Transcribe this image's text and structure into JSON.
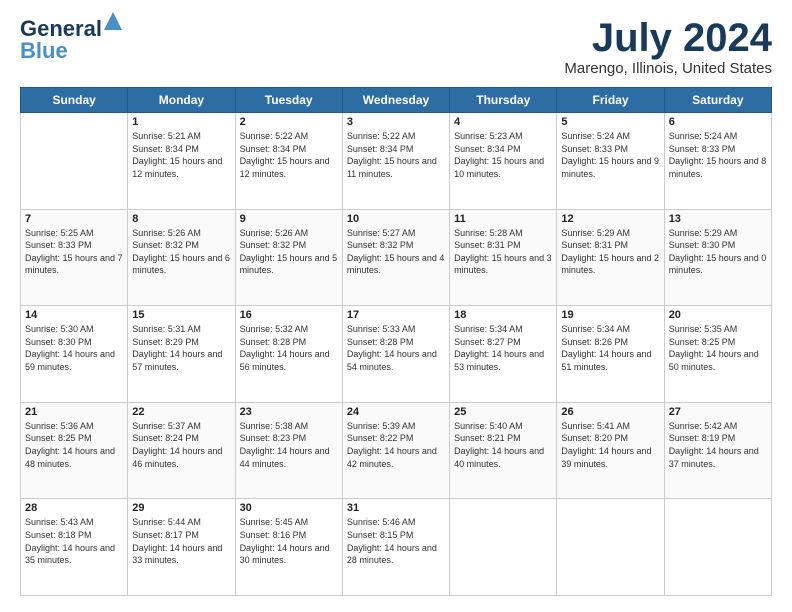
{
  "header": {
    "logo_line1": "General",
    "logo_line2": "Blue",
    "month_year": "July 2024",
    "location": "Marengo, Illinois, United States"
  },
  "weekdays": [
    "Sunday",
    "Monday",
    "Tuesday",
    "Wednesday",
    "Thursday",
    "Friday",
    "Saturday"
  ],
  "weeks": [
    [
      {
        "day": "",
        "sunrise": "",
        "sunset": "",
        "daylight": ""
      },
      {
        "day": "1",
        "sunrise": "Sunrise: 5:21 AM",
        "sunset": "Sunset: 8:34 PM",
        "daylight": "Daylight: 15 hours and 12 minutes."
      },
      {
        "day": "2",
        "sunrise": "Sunrise: 5:22 AM",
        "sunset": "Sunset: 8:34 PM",
        "daylight": "Daylight: 15 hours and 12 minutes."
      },
      {
        "day": "3",
        "sunrise": "Sunrise: 5:22 AM",
        "sunset": "Sunset: 8:34 PM",
        "daylight": "Daylight: 15 hours and 11 minutes."
      },
      {
        "day": "4",
        "sunrise": "Sunrise: 5:23 AM",
        "sunset": "Sunset: 8:34 PM",
        "daylight": "Daylight: 15 hours and 10 minutes."
      },
      {
        "day": "5",
        "sunrise": "Sunrise: 5:24 AM",
        "sunset": "Sunset: 8:33 PM",
        "daylight": "Daylight: 15 hours and 9 minutes."
      },
      {
        "day": "6",
        "sunrise": "Sunrise: 5:24 AM",
        "sunset": "Sunset: 8:33 PM",
        "daylight": "Daylight: 15 hours and 8 minutes."
      }
    ],
    [
      {
        "day": "7",
        "sunrise": "Sunrise: 5:25 AM",
        "sunset": "Sunset: 8:33 PM",
        "daylight": "Daylight: 15 hours and 7 minutes."
      },
      {
        "day": "8",
        "sunrise": "Sunrise: 5:26 AM",
        "sunset": "Sunset: 8:32 PM",
        "daylight": "Daylight: 15 hours and 6 minutes."
      },
      {
        "day": "9",
        "sunrise": "Sunrise: 5:26 AM",
        "sunset": "Sunset: 8:32 PM",
        "daylight": "Daylight: 15 hours and 5 minutes."
      },
      {
        "day": "10",
        "sunrise": "Sunrise: 5:27 AM",
        "sunset": "Sunset: 8:32 PM",
        "daylight": "Daylight: 15 hours and 4 minutes."
      },
      {
        "day": "11",
        "sunrise": "Sunrise: 5:28 AM",
        "sunset": "Sunset: 8:31 PM",
        "daylight": "Daylight: 15 hours and 3 minutes."
      },
      {
        "day": "12",
        "sunrise": "Sunrise: 5:29 AM",
        "sunset": "Sunset: 8:31 PM",
        "daylight": "Daylight: 15 hours and 2 minutes."
      },
      {
        "day": "13",
        "sunrise": "Sunrise: 5:29 AM",
        "sunset": "Sunset: 8:30 PM",
        "daylight": "Daylight: 15 hours and 0 minutes."
      }
    ],
    [
      {
        "day": "14",
        "sunrise": "Sunrise: 5:30 AM",
        "sunset": "Sunset: 8:30 PM",
        "daylight": "Daylight: 14 hours and 59 minutes."
      },
      {
        "day": "15",
        "sunrise": "Sunrise: 5:31 AM",
        "sunset": "Sunset: 8:29 PM",
        "daylight": "Daylight: 14 hours and 57 minutes."
      },
      {
        "day": "16",
        "sunrise": "Sunrise: 5:32 AM",
        "sunset": "Sunset: 8:28 PM",
        "daylight": "Daylight: 14 hours and 56 minutes."
      },
      {
        "day": "17",
        "sunrise": "Sunrise: 5:33 AM",
        "sunset": "Sunset: 8:28 PM",
        "daylight": "Daylight: 14 hours and 54 minutes."
      },
      {
        "day": "18",
        "sunrise": "Sunrise: 5:34 AM",
        "sunset": "Sunset: 8:27 PM",
        "daylight": "Daylight: 14 hours and 53 minutes."
      },
      {
        "day": "19",
        "sunrise": "Sunrise: 5:34 AM",
        "sunset": "Sunset: 8:26 PM",
        "daylight": "Daylight: 14 hours and 51 minutes."
      },
      {
        "day": "20",
        "sunrise": "Sunrise: 5:35 AM",
        "sunset": "Sunset: 8:25 PM",
        "daylight": "Daylight: 14 hours and 50 minutes."
      }
    ],
    [
      {
        "day": "21",
        "sunrise": "Sunrise: 5:36 AM",
        "sunset": "Sunset: 8:25 PM",
        "daylight": "Daylight: 14 hours and 48 minutes."
      },
      {
        "day": "22",
        "sunrise": "Sunrise: 5:37 AM",
        "sunset": "Sunset: 8:24 PM",
        "daylight": "Daylight: 14 hours and 46 minutes."
      },
      {
        "day": "23",
        "sunrise": "Sunrise: 5:38 AM",
        "sunset": "Sunset: 8:23 PM",
        "daylight": "Daylight: 14 hours and 44 minutes."
      },
      {
        "day": "24",
        "sunrise": "Sunrise: 5:39 AM",
        "sunset": "Sunset: 8:22 PM",
        "daylight": "Daylight: 14 hours and 42 minutes."
      },
      {
        "day": "25",
        "sunrise": "Sunrise: 5:40 AM",
        "sunset": "Sunset: 8:21 PM",
        "daylight": "Daylight: 14 hours and 40 minutes."
      },
      {
        "day": "26",
        "sunrise": "Sunrise: 5:41 AM",
        "sunset": "Sunset: 8:20 PM",
        "daylight": "Daylight: 14 hours and 39 minutes."
      },
      {
        "day": "27",
        "sunrise": "Sunrise: 5:42 AM",
        "sunset": "Sunset: 8:19 PM",
        "daylight": "Daylight: 14 hours and 37 minutes."
      }
    ],
    [
      {
        "day": "28",
        "sunrise": "Sunrise: 5:43 AM",
        "sunset": "Sunset: 8:18 PM",
        "daylight": "Daylight: 14 hours and 35 minutes."
      },
      {
        "day": "29",
        "sunrise": "Sunrise: 5:44 AM",
        "sunset": "Sunset: 8:17 PM",
        "daylight": "Daylight: 14 hours and 33 minutes."
      },
      {
        "day": "30",
        "sunrise": "Sunrise: 5:45 AM",
        "sunset": "Sunset: 8:16 PM",
        "daylight": "Daylight: 14 hours and 30 minutes."
      },
      {
        "day": "31",
        "sunrise": "Sunrise: 5:46 AM",
        "sunset": "Sunset: 8:15 PM",
        "daylight": "Daylight: 14 hours and 28 minutes."
      },
      {
        "day": "",
        "sunrise": "",
        "sunset": "",
        "daylight": ""
      },
      {
        "day": "",
        "sunrise": "",
        "sunset": "",
        "daylight": ""
      },
      {
        "day": "",
        "sunrise": "",
        "sunset": "",
        "daylight": ""
      }
    ]
  ]
}
